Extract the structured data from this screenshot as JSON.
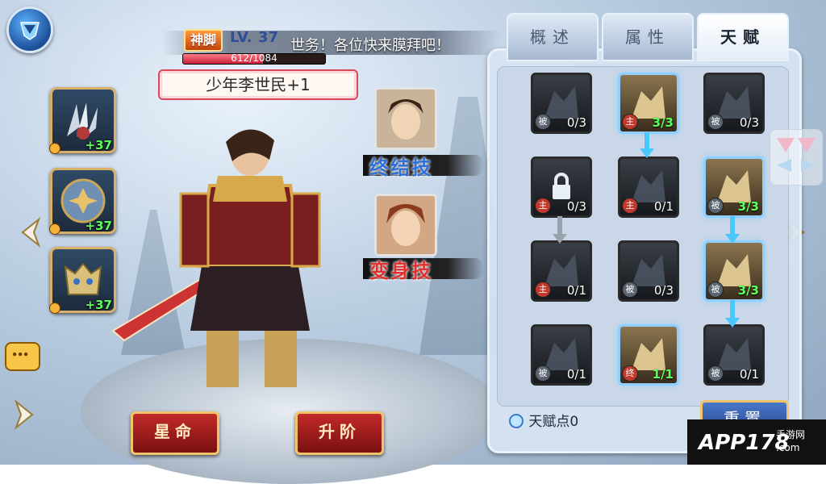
{
  "top_left": {
    "icon": "shield-icon"
  },
  "marquee": {
    "text": "世务！各位快来膜拜吧！"
  },
  "hero": {
    "rank": "神脚",
    "level_label": "LV.",
    "level": "37",
    "xp_text": "612/1084",
    "xp_fraction": 0.565,
    "name": "少年李世民+1"
  },
  "equipment": [
    {
      "icon": "claw-weapon-icon",
      "bonus": "+37"
    },
    {
      "icon": "round-armor-icon",
      "bonus": "+37"
    },
    {
      "icon": "beast-helmet-icon",
      "bonus": "+37"
    }
  ],
  "skills": [
    {
      "label": "终结技",
      "icon": "hero-portrait-icon"
    },
    {
      "label": "变身技",
      "icon": "hero-portrait-red-icon"
    }
  ],
  "buttons": {
    "star": "星命",
    "advance": "升阶",
    "reset": "重置"
  },
  "tabs": [
    {
      "label": "概述",
      "active": false
    },
    {
      "label": "属性",
      "active": false
    },
    {
      "label": "天赋",
      "active": true
    }
  ],
  "talents": [
    {
      "count": "0/3",
      "type": "被",
      "active": false,
      "icon": "dragon-icon"
    },
    {
      "count": "3/3",
      "type": "主",
      "active": true,
      "icon": "dragon-icon"
    },
    {
      "count": "0/3",
      "type": "被",
      "active": false,
      "icon": "horse-icon"
    },
    {
      "count": "0/3",
      "type": "主",
      "active": false,
      "icon": "lock-icon"
    },
    {
      "count": "0/1",
      "type": "主",
      "active": false,
      "icon": "dragon-icon"
    },
    {
      "count": "3/3",
      "type": "被",
      "active": true,
      "icon": "sword-icon"
    },
    {
      "count": "0/1",
      "type": "主",
      "active": false,
      "icon": "armor-icon"
    },
    {
      "count": "0/3",
      "type": "被",
      "active": false,
      "icon": "wolf-icon"
    },
    {
      "count": "3/3",
      "type": "被",
      "active": true,
      "icon": "fortress-icon"
    },
    {
      "count": "0/1",
      "type": "被",
      "active": false,
      "icon": "soldier-icon"
    },
    {
      "count": "1/1",
      "type": "终",
      "active": true,
      "icon": "hero-portrait-icon"
    },
    {
      "count": "0/1",
      "type": "被",
      "active": false,
      "icon": "eagle-icon"
    }
  ],
  "talent_points": {
    "label": "天赋点",
    "value": "0"
  },
  "watermark": {
    "brand": "APP178",
    "sub": "手游网",
    "url": ".com"
  },
  "colors": {
    "accent": "#4ac7ff",
    "green_text": "#5cff5c",
    "red_button": "#c22a2a"
  }
}
